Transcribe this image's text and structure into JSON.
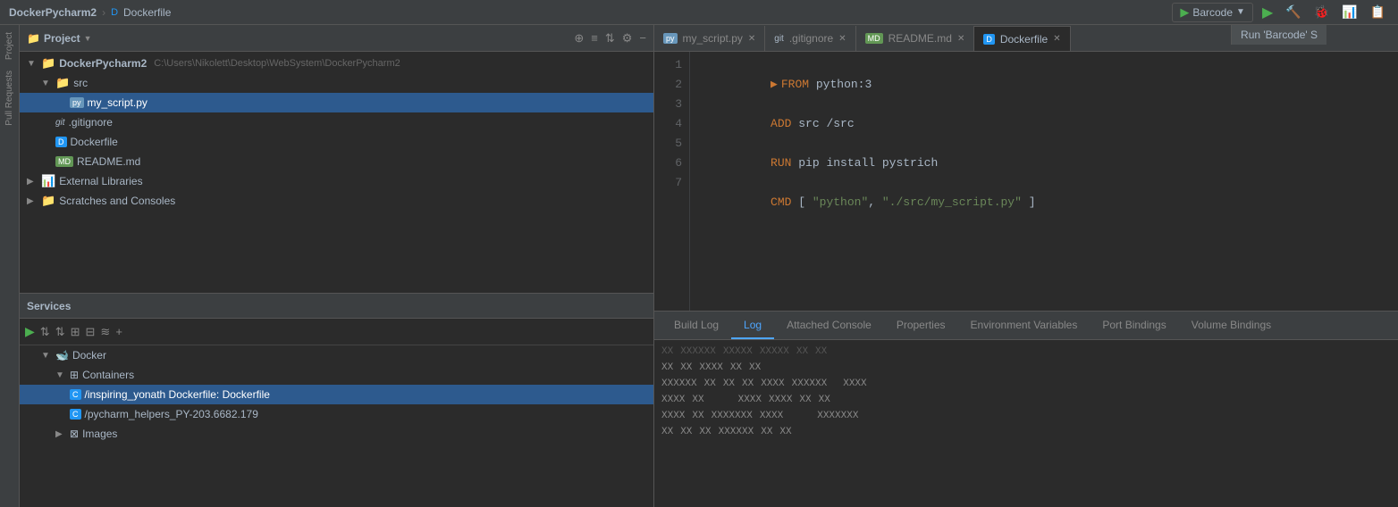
{
  "titleBar": {
    "projectName": "DockerPycharm2",
    "separator": "›",
    "fileName": "Dockerfile",
    "runConfig": "Barcode",
    "runTooltip": "Run 'Barcode' S"
  },
  "projectPanel": {
    "title": "Project",
    "rootFolder": "DockerPycharm2",
    "rootPath": "C:\\Users\\Nikolett\\Desktop\\WebSystem\\DockerPycharm2",
    "items": [
      {
        "label": "DockerPycharm2",
        "type": "folder",
        "indent": 0,
        "expanded": true
      },
      {
        "label": "src",
        "type": "folder",
        "indent": 1,
        "expanded": true
      },
      {
        "label": "my_script.py",
        "type": "py",
        "indent": 2,
        "selected": true
      },
      {
        "label": ".gitignore",
        "type": "git",
        "indent": 1
      },
      {
        "label": "Dockerfile",
        "type": "docker",
        "indent": 1
      },
      {
        "label": "README.md",
        "type": "md",
        "indent": 1
      },
      {
        "label": "External Libraries",
        "type": "folder",
        "indent": 0,
        "expanded": false
      },
      {
        "label": "Scratches and Consoles",
        "type": "folder",
        "indent": 0,
        "expanded": false
      }
    ]
  },
  "editorTabs": [
    {
      "label": "my_script.py",
      "type": "py",
      "active": false,
      "closable": true
    },
    {
      "label": ".gitignore",
      "type": "git",
      "active": false,
      "closable": true
    },
    {
      "label": "README.md",
      "type": "md",
      "active": false,
      "closable": true
    },
    {
      "label": "Dockerfile",
      "type": "docker",
      "active": true,
      "closable": true
    }
  ],
  "editor": {
    "lines": [
      {
        "num": 1,
        "content": "FROM python:3",
        "parts": [
          {
            "text": "FROM ",
            "cls": "kw-from"
          },
          {
            "text": "python:3",
            "cls": "code-normal"
          }
        ]
      },
      {
        "num": 2,
        "content": ""
      },
      {
        "num": 3,
        "content": "ADD src /src",
        "parts": [
          {
            "text": "ADD ",
            "cls": "kw-add"
          },
          {
            "text": "src /src",
            "cls": "code-normal"
          }
        ]
      },
      {
        "num": 4,
        "content": ""
      },
      {
        "num": 5,
        "content": "RUN pip install pystrich",
        "parts": [
          {
            "text": "RUN ",
            "cls": "kw-run"
          },
          {
            "text": "pip install pystrich",
            "cls": "code-normal"
          }
        ]
      },
      {
        "num": 6,
        "content": ""
      },
      {
        "num": 7,
        "content": "CMD [ \"python\", \"./src/my_script.py\" ]",
        "parts": [
          {
            "text": "CMD ",
            "cls": "kw-cmd"
          },
          {
            "text": "[ ",
            "cls": "code-normal"
          },
          {
            "text": "\"python\"",
            "cls": "code-string"
          },
          {
            "text": ", ",
            "cls": "code-normal"
          },
          {
            "text": "\"./src/my_script.py\"",
            "cls": "code-string"
          },
          {
            "text": " ]",
            "cls": "code-normal"
          }
        ]
      }
    ]
  },
  "services": {
    "title": "Services",
    "items": [
      {
        "label": "Docker",
        "type": "docker",
        "indent": 1,
        "expanded": true
      },
      {
        "label": "Containers",
        "type": "containers",
        "indent": 2,
        "expanded": true
      },
      {
        "label": "/inspiring_yonath Dockerfile: Dockerfile",
        "type": "container",
        "indent": 3,
        "selected": true
      },
      {
        "label": "/pycharm_helpers_PY-203.6682.179",
        "type": "container",
        "indent": 3
      },
      {
        "label": "Images",
        "type": "images",
        "indent": 2,
        "expanded": false
      }
    ]
  },
  "bottomTabs": [
    {
      "label": "Build Log",
      "active": false
    },
    {
      "label": "Log",
      "active": true
    },
    {
      "label": "Attached Console",
      "active": false
    },
    {
      "label": "Properties",
      "active": false
    },
    {
      "label": "Environment Variables",
      "active": false
    },
    {
      "label": "Port Bindings",
      "active": false
    },
    {
      "label": "Volume Bindings",
      "active": false
    }
  ],
  "logLines": [
    [
      "XX",
      "XX",
      "XXXX",
      "XX",
      "XX"
    ],
    [
      "XXXXXX",
      "XX",
      "XX",
      "XX",
      "XXXX",
      "XXXXXX",
      "XXXX"
    ],
    [
      "XXXX",
      "XX",
      "XXXX",
      "XXXX",
      "XX",
      "XX"
    ],
    [
      "XXXX",
      "XX",
      "XXXXXXX",
      "XXXX",
      "XXXXXXX"
    ],
    [
      "XX",
      "XX",
      "XX",
      "XXXXXX",
      "XX",
      "XX"
    ]
  ],
  "icons": {
    "folder": "📁",
    "expand": "▶",
    "collapse": "▼",
    "docker": "🐋",
    "py": "py",
    "git": "git",
    "md": "md",
    "close": "✕",
    "dropdown": "▼",
    "run": "▶",
    "settings": "⚙",
    "plus": "+",
    "minus": "−",
    "filter": "⊟",
    "sort": "≡",
    "refresh": "↺",
    "scroll": "⇅",
    "runGreen": "▶",
    "stopRed": "■"
  }
}
